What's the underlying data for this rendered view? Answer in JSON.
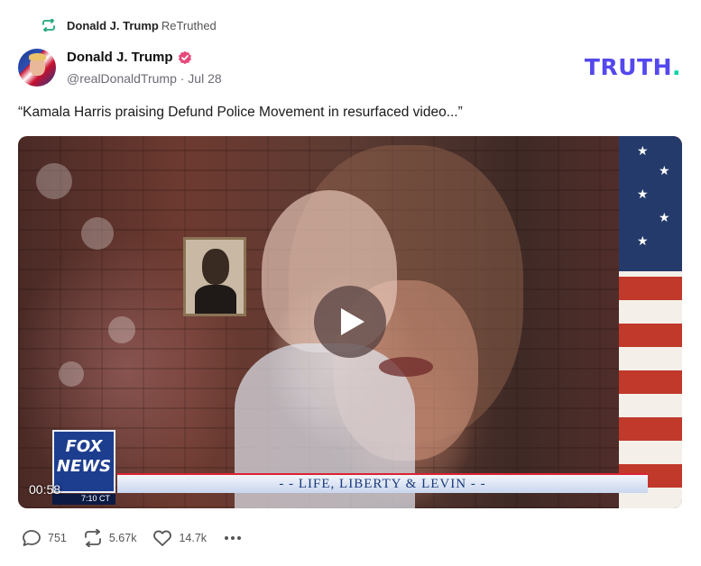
{
  "retruth": {
    "name": "Donald J. Trump",
    "suffix": "ReTruthed",
    "icon": "retruth-icon"
  },
  "post": {
    "author_name": "Donald J. Trump",
    "verified_icon": "verified-badge-icon",
    "handle_date": "@realDonaldTrump · Jul 28",
    "text": "“Kamala Harris praising Defund Police Movement in resurfaced video...”"
  },
  "brand": {
    "logo_text": "TRUTH",
    "logo_dot": ".",
    "primary_color": "#5448ee",
    "accent_color": "#00d3a7"
  },
  "video": {
    "duration": "00:58",
    "lower_third": "- - LIFE, LIBERTY & LEVIN - -",
    "network_top": "FOX",
    "network_bottom": "NEWS",
    "network_clock": "7:10 CT",
    "play_icon": "play-icon"
  },
  "actions": {
    "replies": "751",
    "retruths": "5.67k",
    "likes": "14.7k",
    "reply_icon": "comment-icon",
    "retruth_icon": "retruth-icon",
    "like_icon": "heart-icon",
    "more_icon": "more-icon"
  }
}
